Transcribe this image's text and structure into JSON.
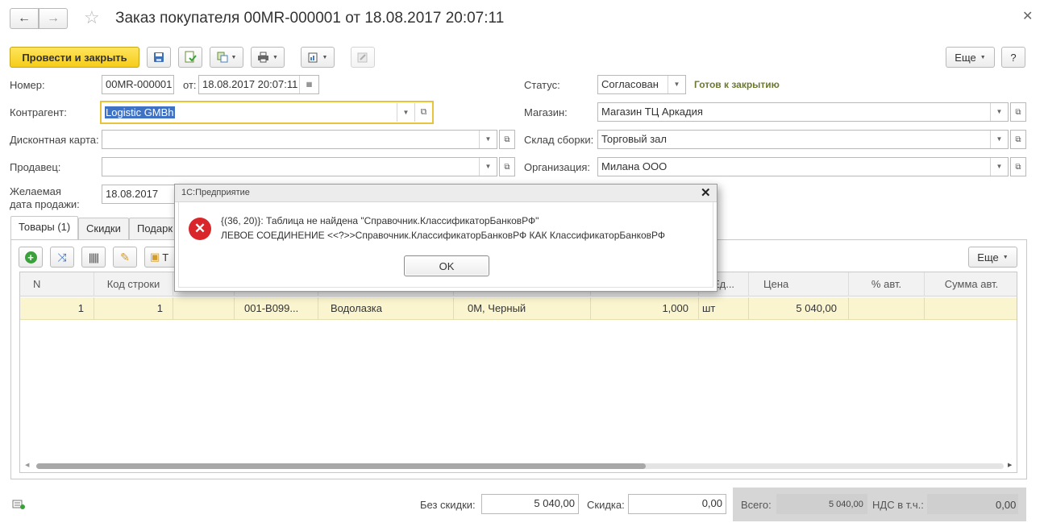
{
  "window": {
    "title": "Заказ покупателя 00MR-000001 от 18.08.2017 20:07:11"
  },
  "toolbar": {
    "post_close_label": "Провести и закрыть",
    "more_label": "Еще",
    "help_label": "?"
  },
  "form": {
    "number_label": "Номер:",
    "number_value": "00MR-000001",
    "from_label": "от:",
    "date_value": "18.08.2017 20:07:11",
    "counterparty_label": "Контрагент:",
    "counterparty_value": "Logistic GMBh",
    "discount_card_label": "Дисконтная карта:",
    "discount_card_value": "",
    "seller_label": "Продавец:",
    "seller_value": "",
    "desired_date_label_1": "Желаемая",
    "desired_date_label_2": "дата продажи:",
    "desired_date_value": "18.08.2017",
    "status_label": "Статус:",
    "status_value": "Согласован",
    "status_hint": "Готов к закрытию",
    "store_label": "Магазин:",
    "store_value": "Магазин ТЦ Аркадия",
    "warehouse_label": "Склад сборки:",
    "warehouse_value": "Торговый зал",
    "org_label": "Организация:",
    "org_value": "Милана ООО"
  },
  "tabs": [
    {
      "label": "Товары (1)"
    },
    {
      "label": "Скидки"
    },
    {
      "label": "Подарк"
    }
  ],
  "table_toolbar": {
    "more_label": "Еще",
    "partial_label": "Т"
  },
  "table": {
    "headers": [
      "N",
      "Код строки",
      "",
      "",
      "",
      "",
      "",
      "Ед...",
      "Цена",
      "% авт.",
      "Сумма авт."
    ],
    "rows": [
      {
        "n": "1",
        "code": "1",
        "c3": "",
        "article": "001-В099...",
        "name": "Водолазка",
        "characteristic": "0М, Черный",
        "qty": "1,000",
        "unit": "шт",
        "price": "5 040,00",
        "auto_pct": "",
        "auto_sum": ""
      }
    ]
  },
  "footer": {
    "no_discount_label": "Без скидки:",
    "no_discount_value": "5 040,00",
    "discount_label": "Скидка:",
    "discount_value": "0,00",
    "total_label": "Всего:",
    "total_value": "5 040,00",
    "vat_label": "НДС в т.ч.:",
    "vat_value": "0,00"
  },
  "dialog": {
    "title": "1С:Предприятие",
    "line1": "{(36, 20)}: Таблица не найдена \"Справочник.КлассификаторБанковРФ\"",
    "line2": "ЛЕВОЕ СОЕДИНЕНИЕ <<?>>Справочник.КлассификаторБанковРФ КАК КлассификаторБанковРФ",
    "ok_label": "OK"
  },
  "colors": {
    "accent_yellow": "#f5cc1a",
    "row_highlight": "#fbf5cf",
    "status_hint": "#6b7a2f",
    "error_red": "#d9262b"
  }
}
